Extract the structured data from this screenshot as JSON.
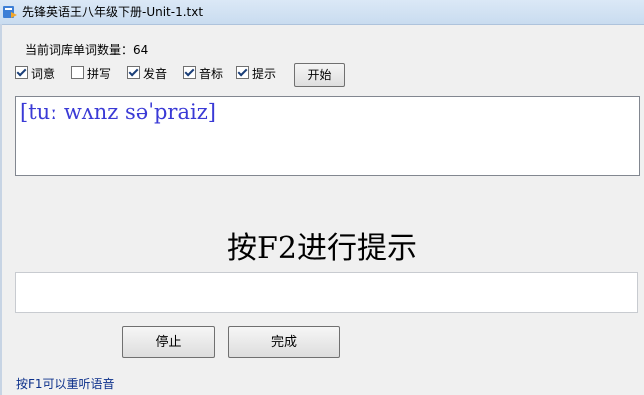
{
  "window": {
    "title": "先锋英语王八年级下册-Unit-1.txt",
    "icon": "app-icon"
  },
  "status": {
    "word_count_text": "当前词库单词数量：64"
  },
  "options": [
    {
      "label": "词意",
      "checked": true
    },
    {
      "label": "拼写",
      "checked": false
    },
    {
      "label": "发音",
      "checked": true
    },
    {
      "label": "音标",
      "checked": true
    },
    {
      "label": "提示",
      "checked": true
    }
  ],
  "buttons": {
    "start": "开始",
    "stop": "停止",
    "done": "完成"
  },
  "phonetic": {
    "text": "[tuː wʌnz səˈpraiz]"
  },
  "prompt": {
    "hint": "按F2进行提示"
  },
  "answer": {
    "value": ""
  },
  "footer": {
    "tip": "按F1可以重听语音"
  },
  "colors": {
    "phonetic": "#3a3ad6",
    "footer": "#0b2f8a"
  }
}
